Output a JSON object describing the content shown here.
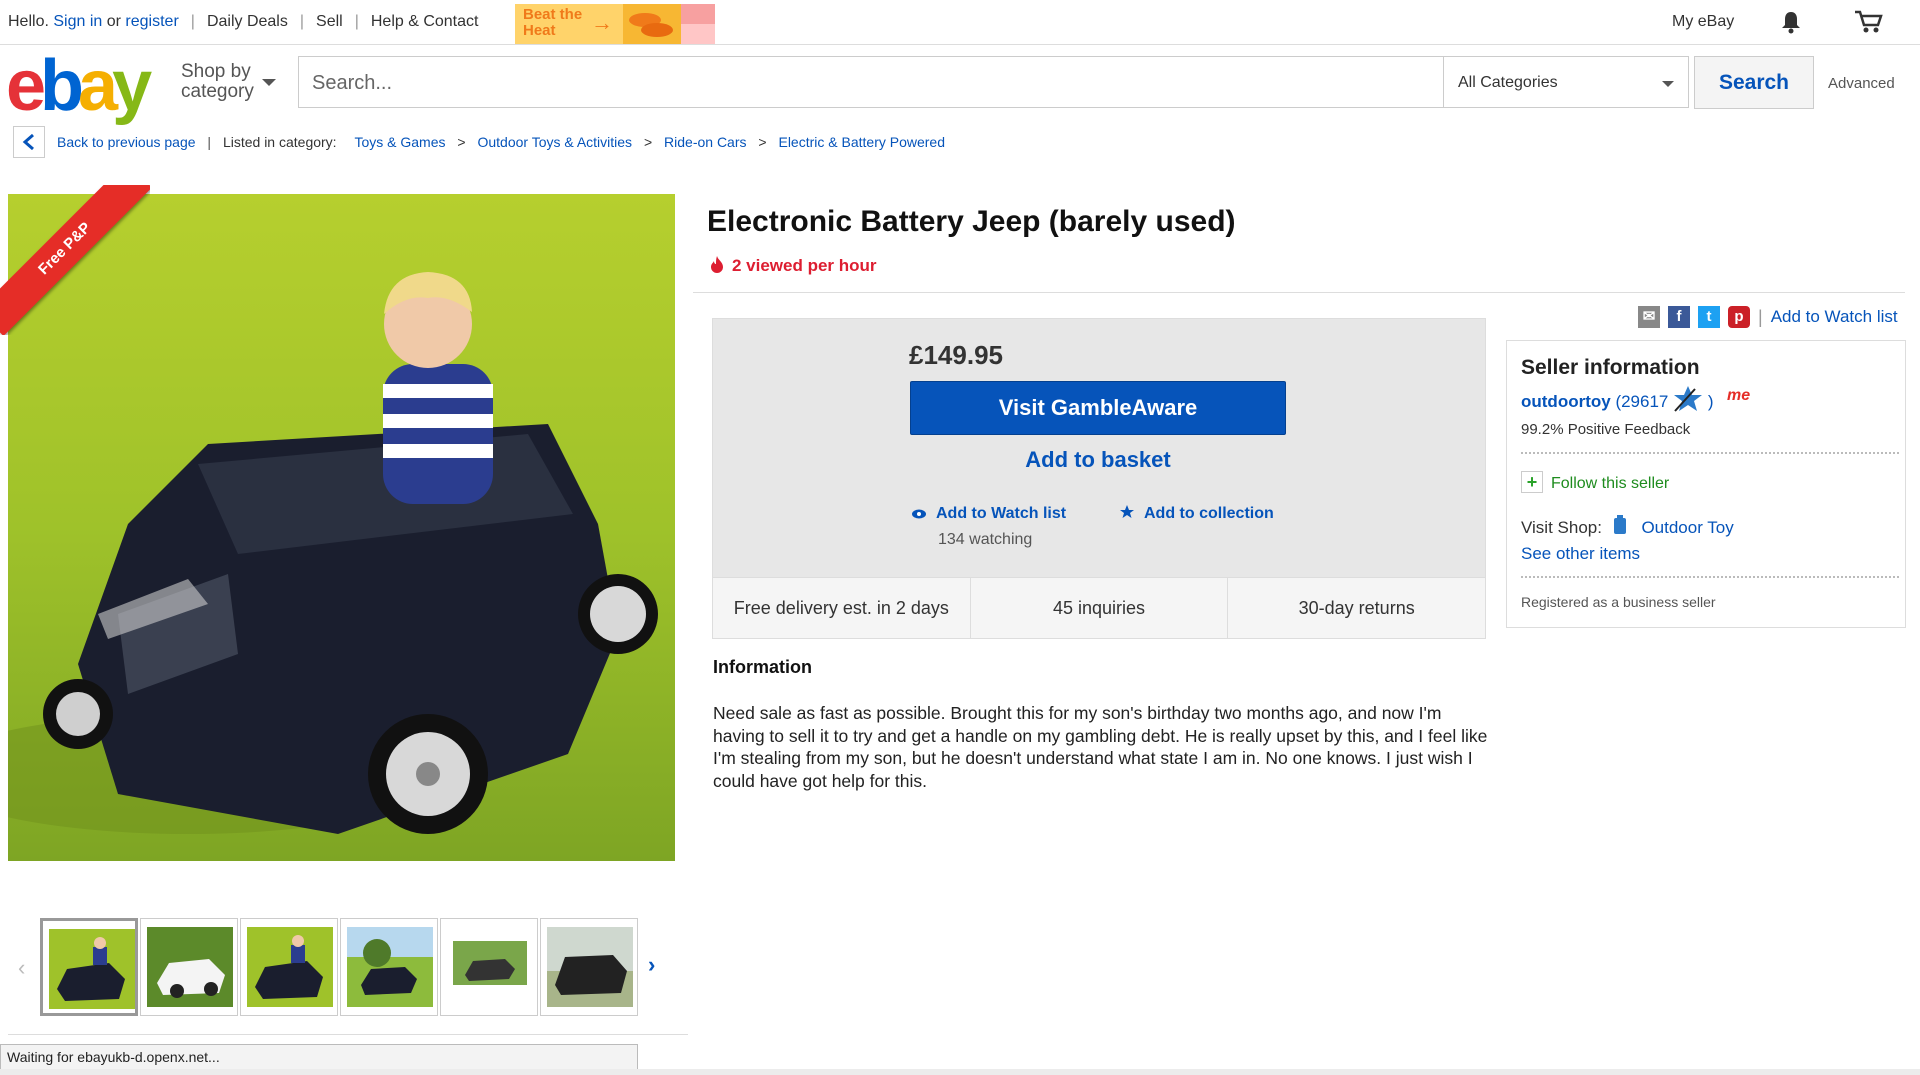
{
  "topbar": {
    "hello": "Hello.",
    "sign_in": "Sign in",
    "or": "or",
    "register": "register",
    "daily_deals": "Daily Deals",
    "sell": "Sell",
    "help": "Help & Contact",
    "promo_line1": "Beat the",
    "promo_line2": "Heat",
    "my_ebay": "My eBay"
  },
  "header": {
    "shop_by_line1": "Shop by",
    "shop_by_line2": "category",
    "search_placeholder": "Search...",
    "category": "All Categories",
    "search_button": "Search",
    "advanced": "Advanced"
  },
  "breadcrumb": {
    "back": "Back to previous page",
    "listed_in": "Listed in category:",
    "items": [
      "Toys & Games",
      "Outdoor Toys & Activities",
      "Ride-on Cars",
      "Electric & Battery Powered"
    ],
    "sep": ">"
  },
  "image": {
    "ribbon": "Free P&P"
  },
  "listing": {
    "title": "Electronic Battery Jeep (barely used)",
    "views": "2 viewed per hour",
    "price": "£149.95",
    "gamble_button": "Visit GambleAware",
    "basket_button": "Add to basket",
    "watch": "Add to Watch list",
    "watching": "134 watching",
    "collection": "Add to collection",
    "features": [
      "Free delivery est. in 2 days",
      "45 inquiries",
      "30-day returns"
    ],
    "info_heading": "Information",
    "description": "Need sale as fast as possible. Brought this for my son's birthday two months ago, and now I'm having to sell it to try and get a handle on my gambling debt. He is really upset by this, and I feel like I'm stealing from my son, but he doesn't understand what state I am in. No one knows. I just wish I could have got help for this."
  },
  "share": {
    "sep": "|",
    "add_watch": "Add to Watch list"
  },
  "seller": {
    "heading": "Seller information",
    "name": "outdoortoy",
    "score": "(29617",
    "score_close": ")",
    "me_badge": "me",
    "feedback": "99.2% Positive Feedback",
    "follow": "Follow this seller",
    "visit_shop": "Visit Shop:",
    "shop_name": "Outdoor Toy",
    "see_other": "See other items",
    "registered": "Registered as a business seller"
  },
  "status_text": "Waiting for ebayukb-d.openx.net..."
}
